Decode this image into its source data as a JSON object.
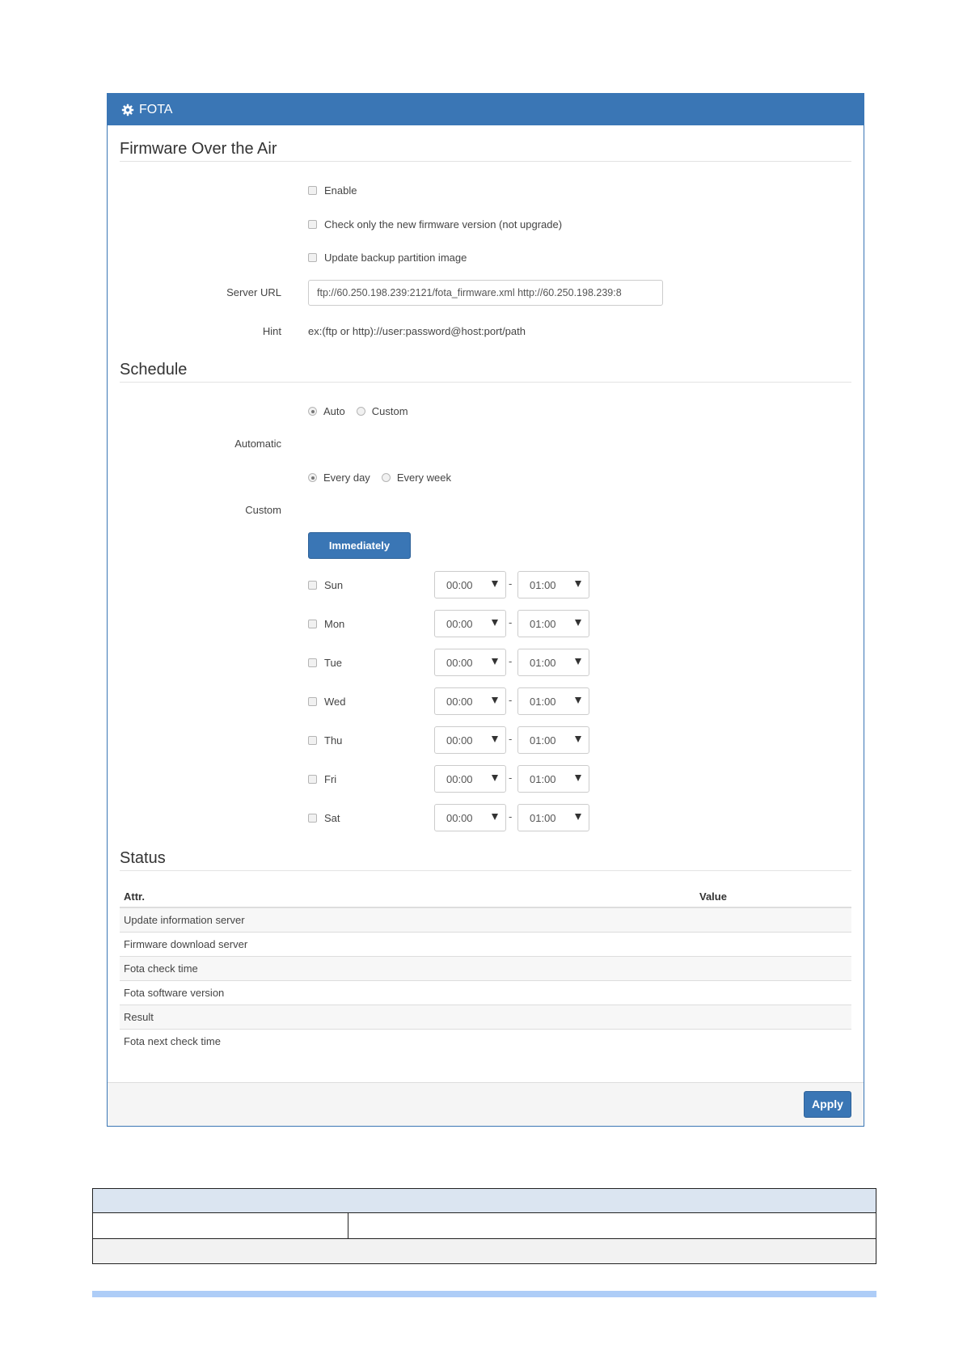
{
  "panel": {
    "title": "FOTA",
    "icon": "gear-icon",
    "accent_color": "#3a76b5"
  },
  "firmware": {
    "section_title": "Firmware Over the Air",
    "enable_label": "Enable",
    "check_only_label": "Check only the new firmware version (not upgrade)",
    "backup_label": "Update backup partition image",
    "server_url_label": "Server URL",
    "server_url_value": "ftp://60.250.198.239:2121/fota_firmware.xml http://60.250.198.239:8",
    "hint_label": "Hint",
    "hint_text": "ex:(ftp or http)://user:password@host:port/path"
  },
  "schedule": {
    "section_title": "Schedule",
    "auto_label": "Auto",
    "custom_label": "Custom",
    "mode_selected": "Auto",
    "automatic_label": "Automatic",
    "every_day_label": "Every day",
    "every_week_label": "Every week",
    "frequency_selected": "Every day",
    "custom_row_label": "Custom",
    "immediately_label": "Immediately",
    "range_separator": "-",
    "days": [
      {
        "name": "Sun",
        "start": "00:00",
        "end": "01:00"
      },
      {
        "name": "Mon",
        "start": "00:00",
        "end": "01:00"
      },
      {
        "name": "Tue",
        "start": "00:00",
        "end": "01:00"
      },
      {
        "name": "Wed",
        "start": "00:00",
        "end": "01:00"
      },
      {
        "name": "Thu",
        "start": "00:00",
        "end": "01:00"
      },
      {
        "name": "Fri",
        "start": "00:00",
        "end": "01:00"
      },
      {
        "name": "Sat",
        "start": "00:00",
        "end": "01:00"
      }
    ]
  },
  "status": {
    "section_title": "Status",
    "col_attr": "Attr.",
    "col_value": "Value",
    "rows": [
      {
        "attr": "Update information server",
        "value": ""
      },
      {
        "attr": "Firmware download server",
        "value": ""
      },
      {
        "attr": "Fota check time",
        "value": ""
      },
      {
        "attr": "Fota software version",
        "value": ""
      },
      {
        "attr": "Result",
        "value": ""
      },
      {
        "attr": "Fota next check time",
        "value": ""
      }
    ]
  },
  "footer": {
    "apply_label": "Apply"
  }
}
